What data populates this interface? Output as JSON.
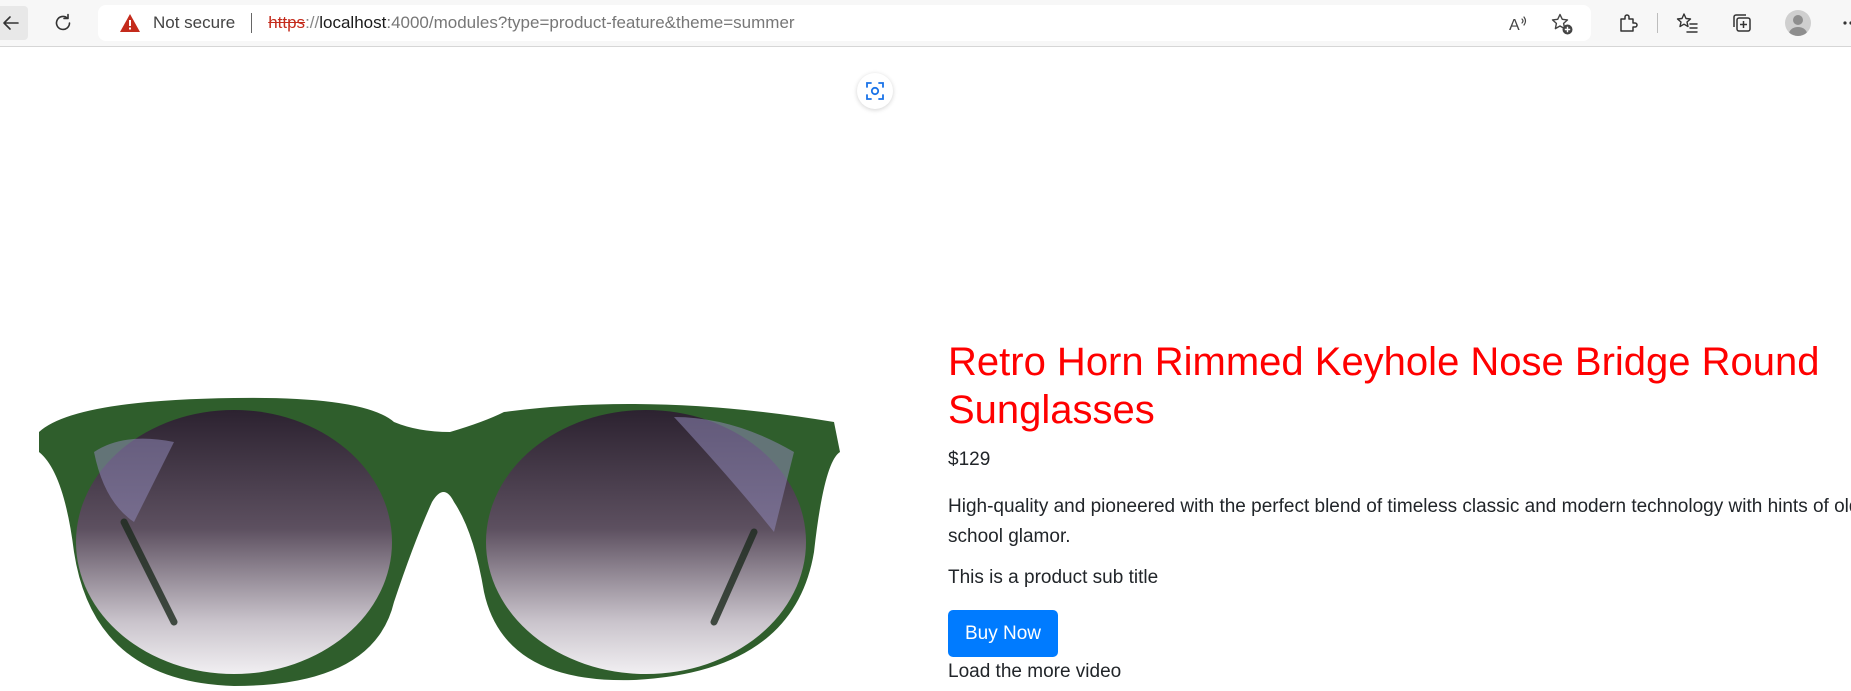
{
  "browser": {
    "security_label": "Not secure",
    "url": {
      "scheme": "https",
      "separator": "://",
      "host": "localhost",
      "rest": ":4000/modules?type=product-feature&theme=summer"
    },
    "icons": {
      "back": "arrow-left-icon",
      "reload": "refresh-icon",
      "warning": "warning-triangle-icon",
      "read_aloud": "read-aloud-icon",
      "add_favorite": "star-plus-icon",
      "extensions": "puzzle-icon",
      "favorites": "favorites-list-icon",
      "collections": "collections-icon",
      "profile": "user-avatar-icon",
      "more": "more-icon"
    },
    "colors": {
      "warning": "#c42b1c",
      "toolbar_bg": "#f7f7f7"
    }
  },
  "page": {
    "capture_icon": "screen-capture-icon",
    "product": {
      "title": "Retro Horn Rimmed Keyhole Nose Bridge Round Sunglasses",
      "price": "$129",
      "description": "High-quality and pioneered with the perfect blend of timeless classic and modern technology with hints of old school glamor.",
      "subtitle": "This is a product sub title",
      "buy_button_label": "Buy Now",
      "partial_text": "Load the more video",
      "image_alt": "Green round sunglasses with gradient lenses"
    },
    "colors": {
      "title": "#ff0000",
      "button_bg": "#007bff",
      "button_text": "#ffffff",
      "frame": "#2f5e2c"
    }
  }
}
